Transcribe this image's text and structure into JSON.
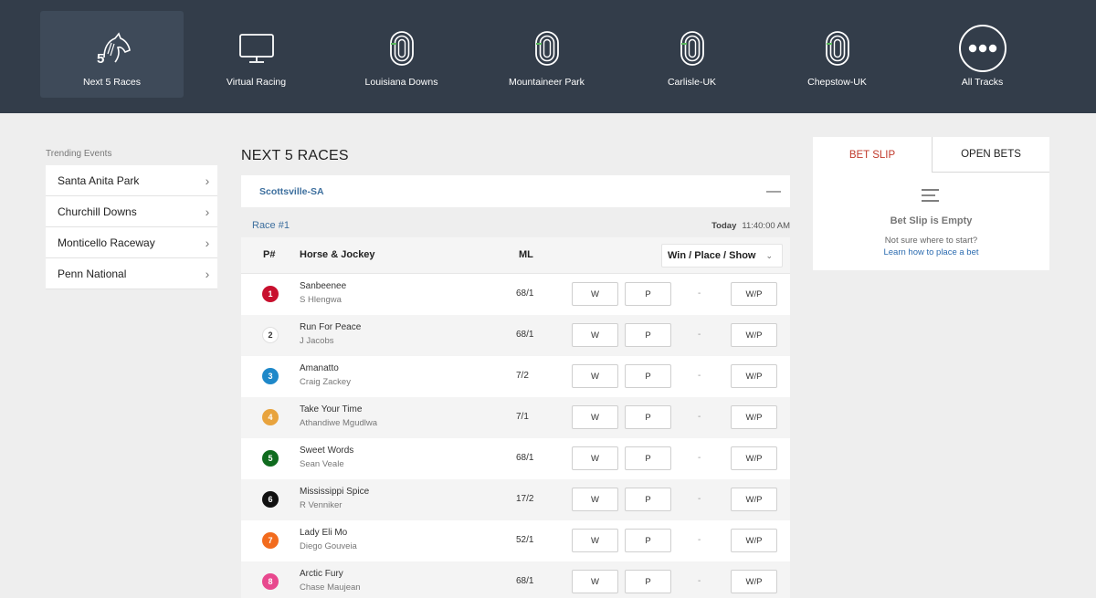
{
  "nav": {
    "items": [
      {
        "label": "Next 5 Races",
        "icon": "horse-head-5-icon",
        "active": true
      },
      {
        "label": "Virtual Racing",
        "icon": "monitor-icon"
      },
      {
        "label": "Louisiana Downs",
        "icon": "racetrack-icon"
      },
      {
        "label": "Mountaineer Park",
        "icon": "racetrack-icon"
      },
      {
        "label": "Carlisle-UK",
        "icon": "racetrack-icon"
      },
      {
        "label": "Chepstow-UK",
        "icon": "racetrack-icon"
      },
      {
        "label": "All Tracks",
        "icon": "more-dots-icon"
      }
    ],
    "badge_digit": "5"
  },
  "sidebar": {
    "title": "Trending Events",
    "items": [
      {
        "label": "Santa Anita Park"
      },
      {
        "label": "Churchill Downs"
      },
      {
        "label": "Monticello Raceway"
      },
      {
        "label": "Penn National"
      }
    ]
  },
  "main": {
    "title": "NEXT 5 RACES",
    "track": "Scottsville-SA",
    "collapse": "—",
    "race_label": "Race #1",
    "race_day": "Today",
    "race_time": "11:40:00 AM",
    "headers": {
      "pn": "P#",
      "horse": "Horse & Jockey",
      "ml": "ML"
    },
    "bet_type": "Win / Place / Show",
    "button_labels": {
      "w": "W",
      "p": "P",
      "wp": "W/P",
      "dash": "-"
    },
    "runners": [
      {
        "num": "1",
        "horse": "Sanbeenee",
        "jockey": "S Hlengwa",
        "ml": "68/1",
        "color": "#c8102e"
      },
      {
        "num": "2",
        "horse": "Run For Peace",
        "jockey": "J Jacobs",
        "ml": "68/1",
        "color": "#ffffff"
      },
      {
        "num": "3",
        "horse": "Amanatto",
        "jockey": "Craig Zackey",
        "ml": "7/2",
        "color": "#1e88c9"
      },
      {
        "num": "4",
        "horse": "Take Your Time",
        "jockey": "Athandiwe Mgudlwa",
        "ml": "7/1",
        "color": "#e8a33d"
      },
      {
        "num": "5",
        "horse": "Sweet Words",
        "jockey": "Sean Veale",
        "ml": "68/1",
        "color": "#0f6b1e"
      },
      {
        "num": "6",
        "horse": "Mississippi Spice",
        "jockey": "R Venniker",
        "ml": "17/2",
        "color": "#111111"
      },
      {
        "num": "7",
        "horse": "Lady Eli Mo",
        "jockey": "Diego Gouveia",
        "ml": "52/1",
        "color": "#f26b1d"
      },
      {
        "num": "8",
        "horse": "Arctic Fury",
        "jockey": "Chase Maujean",
        "ml": "68/1",
        "color": "#e8488e"
      }
    ]
  },
  "betslip": {
    "tab_bet": "BET SLIP",
    "tab_open": "OPEN BETS",
    "empty": "Bet Slip is Empty",
    "hint": "Not sure where to start?",
    "link": "Learn how to place a bet"
  },
  "colors": {
    "nav_bg": "#333d4a",
    "accent_link": "#3d6f9e",
    "active_tab": "#c0392b"
  }
}
